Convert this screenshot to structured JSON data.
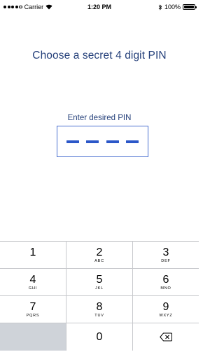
{
  "status_bar": {
    "carrier": "Carrier",
    "time": "1:20 PM",
    "battery": "100%",
    "signal_icon": "signal-dots-icon",
    "wifi_icon": "wifi-icon",
    "bluetooth_icon": "bluetooth-icon",
    "battery_icon": "battery-icon"
  },
  "screen": {
    "title": "Choose a secret 4 digit PIN",
    "pin_label": "Enter desired PIN",
    "pin_slots_filled": 0,
    "pin_slots_total": 4
  },
  "colors": {
    "title": "#25407a",
    "pin_border": "#4a6fd0",
    "pin_dash": "#2b57c8",
    "keypad_blank": "#cfd3d9"
  },
  "keypad": {
    "rows": [
      [
        {
          "digit": "1",
          "letters": ""
        },
        {
          "digit": "2",
          "letters": "ABC"
        },
        {
          "digit": "3",
          "letters": "DEF"
        }
      ],
      [
        {
          "digit": "4",
          "letters": "GHI"
        },
        {
          "digit": "5",
          "letters": "JKL"
        },
        {
          "digit": "6",
          "letters": "MNO"
        }
      ],
      [
        {
          "digit": "7",
          "letters": "PQRS"
        },
        {
          "digit": "8",
          "letters": "TUV"
        },
        {
          "digit": "9",
          "letters": "WXYZ"
        }
      ]
    ],
    "zero": "0",
    "delete_icon": "backspace-icon"
  }
}
